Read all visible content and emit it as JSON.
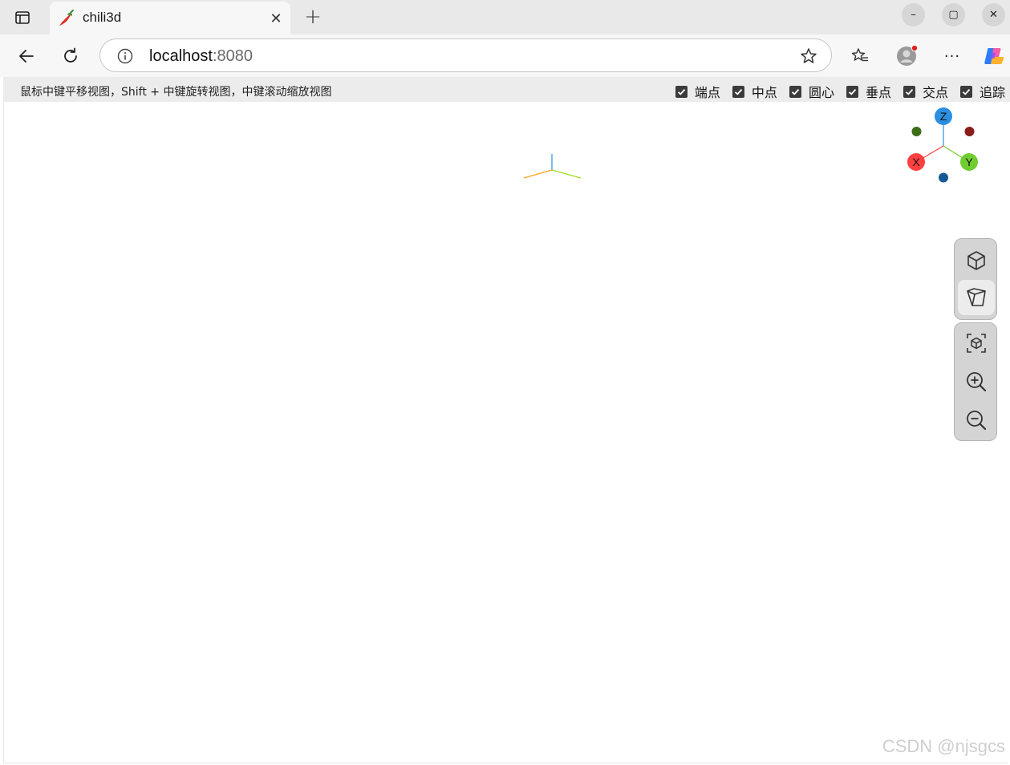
{
  "browser": {
    "tab": {
      "title": "chili3d",
      "close_glyph": "✕"
    },
    "new_tab_glyph": "+",
    "window_controls": {
      "minimize": "–",
      "maximize": "▢",
      "close": "✕"
    },
    "address": {
      "host": "localhost",
      "port": ":8080"
    },
    "more_glyph": "···"
  },
  "app": {
    "hint": "鼠标中键平移视图，Shift + 中键旋转视图，中键滚动缩放视图",
    "snaps": [
      {
        "label": "端点",
        "checked": true
      },
      {
        "label": "中点",
        "checked": true
      },
      {
        "label": "圆心",
        "checked": true
      },
      {
        "label": "垂点",
        "checked": true
      },
      {
        "label": "交点",
        "checked": true
      },
      {
        "label": "追踪",
        "checked": true
      }
    ],
    "navcube": {
      "z": "Z",
      "x": "X",
      "y": "Y"
    },
    "colors": {
      "x_axis": "#ff4040",
      "y_axis": "#70cc30",
      "z_axis": "#2a8fe0",
      "neg_x": "#8b1c1c",
      "neg_y": "#3c6e18",
      "neg_z": "#155a96"
    },
    "view_buttons": [
      {
        "icon": "perspective-cube-icon",
        "active": false
      },
      {
        "icon": "orthographic-cube-icon",
        "active": true
      }
    ],
    "zoom_buttons": [
      {
        "icon": "fit-all-icon"
      },
      {
        "icon": "zoom-in-icon"
      },
      {
        "icon": "zoom-out-icon"
      }
    ]
  },
  "watermark": "CSDN @njsgcs"
}
